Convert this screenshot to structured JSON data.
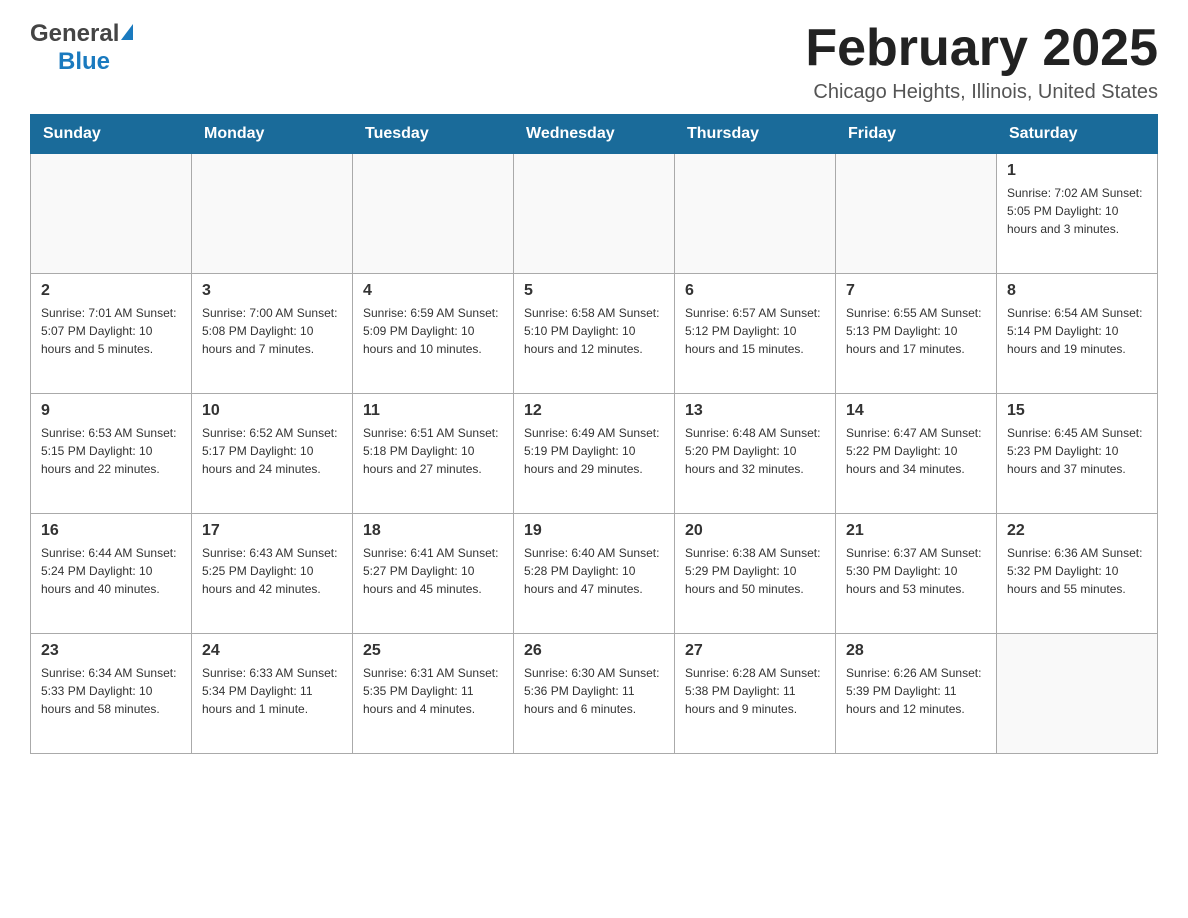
{
  "header": {
    "month_title": "February 2025",
    "location": "Chicago Heights, Illinois, United States",
    "logo_general": "General",
    "logo_blue": "Blue"
  },
  "days_of_week": [
    "Sunday",
    "Monday",
    "Tuesday",
    "Wednesday",
    "Thursday",
    "Friday",
    "Saturday"
  ],
  "weeks": [
    [
      {
        "day": "",
        "info": ""
      },
      {
        "day": "",
        "info": ""
      },
      {
        "day": "",
        "info": ""
      },
      {
        "day": "",
        "info": ""
      },
      {
        "day": "",
        "info": ""
      },
      {
        "day": "",
        "info": ""
      },
      {
        "day": "1",
        "info": "Sunrise: 7:02 AM\nSunset: 5:05 PM\nDaylight: 10 hours and 3 minutes."
      }
    ],
    [
      {
        "day": "2",
        "info": "Sunrise: 7:01 AM\nSunset: 5:07 PM\nDaylight: 10 hours and 5 minutes."
      },
      {
        "day": "3",
        "info": "Sunrise: 7:00 AM\nSunset: 5:08 PM\nDaylight: 10 hours and 7 minutes."
      },
      {
        "day": "4",
        "info": "Sunrise: 6:59 AM\nSunset: 5:09 PM\nDaylight: 10 hours and 10 minutes."
      },
      {
        "day": "5",
        "info": "Sunrise: 6:58 AM\nSunset: 5:10 PM\nDaylight: 10 hours and 12 minutes."
      },
      {
        "day": "6",
        "info": "Sunrise: 6:57 AM\nSunset: 5:12 PM\nDaylight: 10 hours and 15 minutes."
      },
      {
        "day": "7",
        "info": "Sunrise: 6:55 AM\nSunset: 5:13 PM\nDaylight: 10 hours and 17 minutes."
      },
      {
        "day": "8",
        "info": "Sunrise: 6:54 AM\nSunset: 5:14 PM\nDaylight: 10 hours and 19 minutes."
      }
    ],
    [
      {
        "day": "9",
        "info": "Sunrise: 6:53 AM\nSunset: 5:15 PM\nDaylight: 10 hours and 22 minutes."
      },
      {
        "day": "10",
        "info": "Sunrise: 6:52 AM\nSunset: 5:17 PM\nDaylight: 10 hours and 24 minutes."
      },
      {
        "day": "11",
        "info": "Sunrise: 6:51 AM\nSunset: 5:18 PM\nDaylight: 10 hours and 27 minutes."
      },
      {
        "day": "12",
        "info": "Sunrise: 6:49 AM\nSunset: 5:19 PM\nDaylight: 10 hours and 29 minutes."
      },
      {
        "day": "13",
        "info": "Sunrise: 6:48 AM\nSunset: 5:20 PM\nDaylight: 10 hours and 32 minutes."
      },
      {
        "day": "14",
        "info": "Sunrise: 6:47 AM\nSunset: 5:22 PM\nDaylight: 10 hours and 34 minutes."
      },
      {
        "day": "15",
        "info": "Sunrise: 6:45 AM\nSunset: 5:23 PM\nDaylight: 10 hours and 37 minutes."
      }
    ],
    [
      {
        "day": "16",
        "info": "Sunrise: 6:44 AM\nSunset: 5:24 PM\nDaylight: 10 hours and 40 minutes."
      },
      {
        "day": "17",
        "info": "Sunrise: 6:43 AM\nSunset: 5:25 PM\nDaylight: 10 hours and 42 minutes."
      },
      {
        "day": "18",
        "info": "Sunrise: 6:41 AM\nSunset: 5:27 PM\nDaylight: 10 hours and 45 minutes."
      },
      {
        "day": "19",
        "info": "Sunrise: 6:40 AM\nSunset: 5:28 PM\nDaylight: 10 hours and 47 minutes."
      },
      {
        "day": "20",
        "info": "Sunrise: 6:38 AM\nSunset: 5:29 PM\nDaylight: 10 hours and 50 minutes."
      },
      {
        "day": "21",
        "info": "Sunrise: 6:37 AM\nSunset: 5:30 PM\nDaylight: 10 hours and 53 minutes."
      },
      {
        "day": "22",
        "info": "Sunrise: 6:36 AM\nSunset: 5:32 PM\nDaylight: 10 hours and 55 minutes."
      }
    ],
    [
      {
        "day": "23",
        "info": "Sunrise: 6:34 AM\nSunset: 5:33 PM\nDaylight: 10 hours and 58 minutes."
      },
      {
        "day": "24",
        "info": "Sunrise: 6:33 AM\nSunset: 5:34 PM\nDaylight: 11 hours and 1 minute."
      },
      {
        "day": "25",
        "info": "Sunrise: 6:31 AM\nSunset: 5:35 PM\nDaylight: 11 hours and 4 minutes."
      },
      {
        "day": "26",
        "info": "Sunrise: 6:30 AM\nSunset: 5:36 PM\nDaylight: 11 hours and 6 minutes."
      },
      {
        "day": "27",
        "info": "Sunrise: 6:28 AM\nSunset: 5:38 PM\nDaylight: 11 hours and 9 minutes."
      },
      {
        "day": "28",
        "info": "Sunrise: 6:26 AM\nSunset: 5:39 PM\nDaylight: 11 hours and 12 minutes."
      },
      {
        "day": "",
        "info": ""
      }
    ]
  ]
}
